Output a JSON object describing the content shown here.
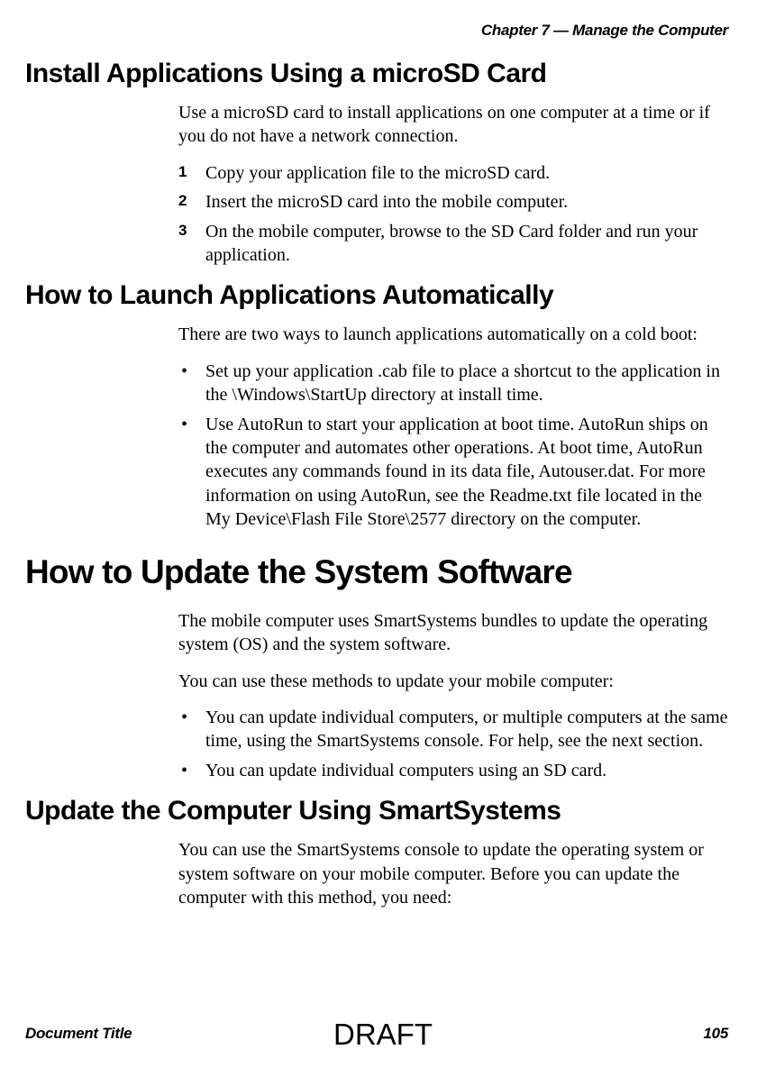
{
  "header": {
    "running_head": "Chapter 7 — Manage the Computer"
  },
  "section1": {
    "heading": "Install Applications Using a microSD Card",
    "intro": "Use a microSD card to install applications on one computer at a time or if you do not have a network connection.",
    "steps": [
      "Copy your application file to the microSD card.",
      "Insert the microSD card into the mobile computer.",
      "On the mobile computer, browse to the SD Card folder and run your application."
    ]
  },
  "section2": {
    "heading": "How to Launch Applications Automatically",
    "intro": "There are two ways to launch applications automatically on a cold boot:",
    "bullets": [
      "Set up your application .cab file to place a shortcut to the application in the \\Windows\\StartUp directory at install time.",
      "Use AutoRun to start your application at boot time. AutoRun ships on the computer and automates other operations. At boot time, AutoRun executes any commands found in its data file, Autouser.dat. For more information on using AutoRun, see the Readme.txt file located in the My Device\\Flash File Store\\2577 directory on the computer."
    ]
  },
  "section3": {
    "heading": "How to Update the System Software",
    "p1": "The mobile computer uses SmartSystems bundles to update the operating system (OS) and the system software.",
    "p2": "You can use these methods to update your mobile computer:",
    "bullets": [
      "You can update individual computers, or multiple computers at the same time, using the SmartSystems console. For help, see the next section.",
      "You can update individual computers using an SD card."
    ]
  },
  "section4": {
    "heading": "Update the Computer Using SmartSystems",
    "intro": "You can use the SmartSystems console to update the operating system or system software on your mobile computer. Before you can update the computer with this method, you need:"
  },
  "footer": {
    "doc_title": "Document Title",
    "page_number": "105",
    "watermark": "DRAFT"
  },
  "step_nums": [
    "1",
    "2",
    "3"
  ]
}
